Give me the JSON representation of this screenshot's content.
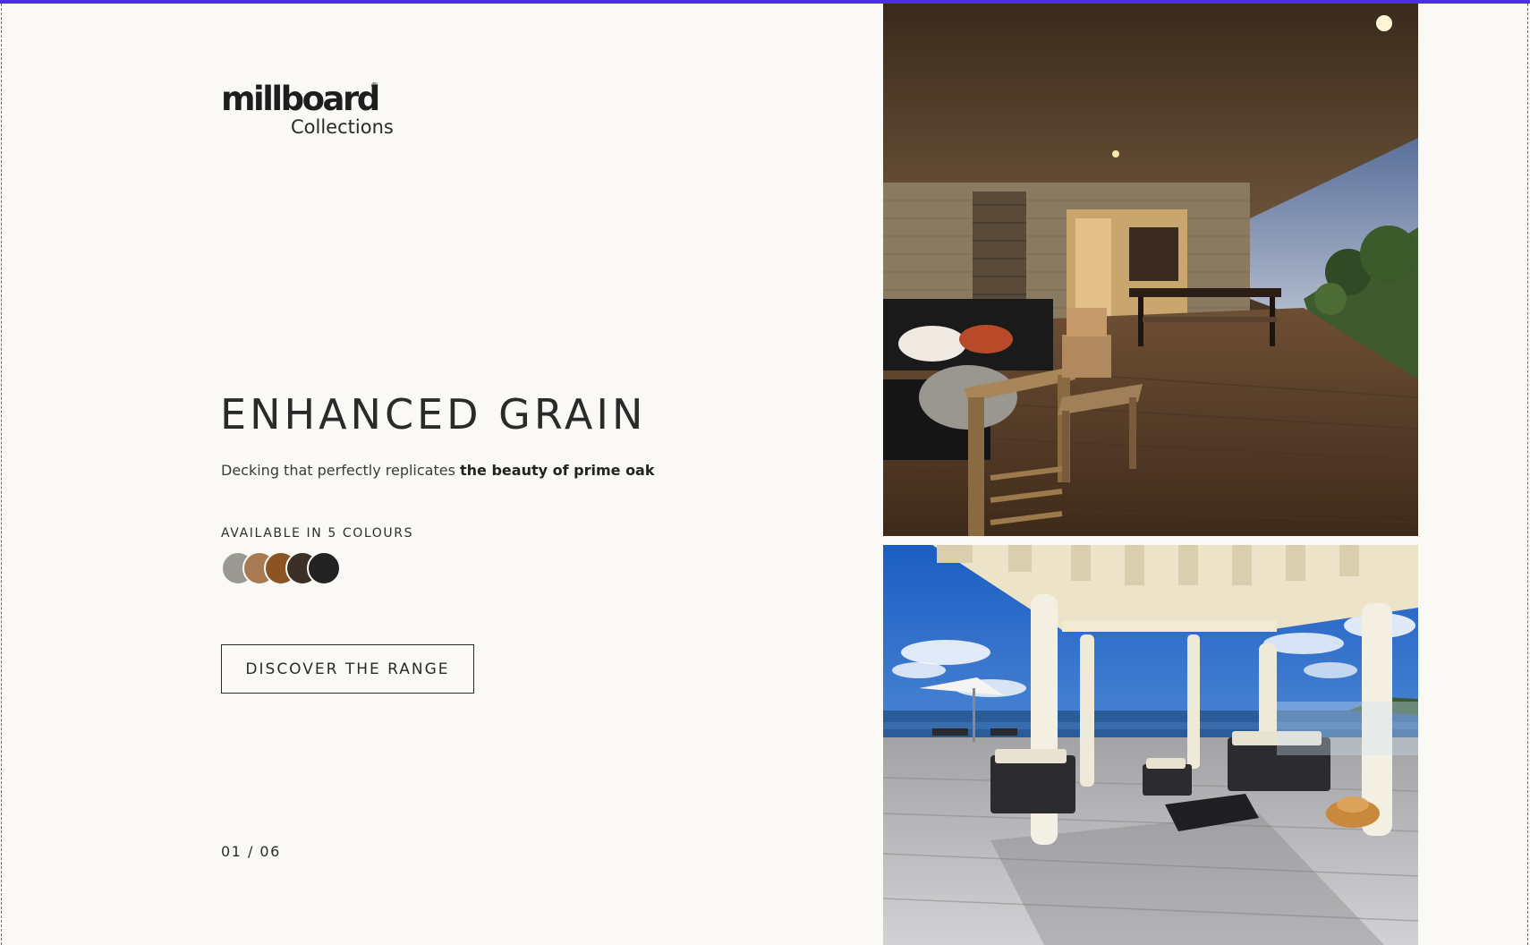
{
  "brand": {
    "logo_word": "millboard",
    "logo_registered": "®",
    "logo_sub": "Collections"
  },
  "hero": {
    "headline": "ENHANCED GRAIN",
    "tagline_plain": "Decking that perfectly replicates ",
    "tagline_bold": "the beauty of prime oak",
    "colours_label": "AVAILABLE IN 5 COLOURS",
    "cta_label": "DISCOVER THE RANGE",
    "pager": "01 / 06"
  },
  "swatches": [
    {
      "name": "grey",
      "color": "#9a9a92"
    },
    {
      "name": "light-oak",
      "color": "#a87a52"
    },
    {
      "name": "golden-oak",
      "color": "#8a5424"
    },
    {
      "name": "dark-brown",
      "color": "#3b2f28"
    },
    {
      "name": "charcoal",
      "color": "#232323"
    }
  ],
  "colors": {
    "background": "#faf9f6",
    "text": "#2a2a2a",
    "top_bar": "#4b2ee8"
  },
  "images": [
    {
      "name": "covered-patio-photo"
    },
    {
      "name": "sea-view-pergola-photo"
    }
  ]
}
